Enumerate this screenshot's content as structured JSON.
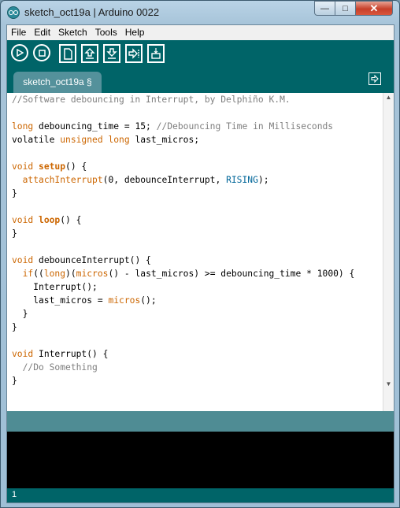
{
  "window": {
    "title": "sketch_oct19a | Arduino 0022",
    "minimize": "—",
    "maximize": "□",
    "close": "✕"
  },
  "menu": [
    "File",
    "Edit",
    "Sketch",
    "Tools",
    "Help"
  ],
  "toolbar": {
    "buttons": [
      "verify",
      "stop",
      "new",
      "open",
      "save",
      "upload",
      "serial-monitor"
    ]
  },
  "tab": {
    "label": "sketch_oct19a §"
  },
  "code_lines": [
    [
      {
        "t": "//Software debouncing in Interrupt, by Delphiño K.M.",
        "c": "cm"
      }
    ],
    [],
    [
      {
        "t": "long",
        "c": "kw"
      },
      {
        "t": " debouncing_time = 15; "
      },
      {
        "t": "//Debouncing Time in Milliseconds",
        "c": "cm"
      }
    ],
    [
      {
        "t": "volatile "
      },
      {
        "t": "unsigned",
        "c": "kw"
      },
      {
        "t": " "
      },
      {
        "t": "long",
        "c": "kw"
      },
      {
        "t": " last_micros;"
      }
    ],
    [],
    [
      {
        "t": "void",
        "c": "kw"
      },
      {
        "t": " "
      },
      {
        "t": "setup",
        "c": "kwb"
      },
      {
        "t": "() {"
      }
    ],
    [
      {
        "t": "  "
      },
      {
        "t": "attachInterrupt",
        "c": "kw"
      },
      {
        "t": "(0, debounceInterrupt, "
      },
      {
        "t": "RISING",
        "c": "lit"
      },
      {
        "t": ");"
      }
    ],
    [
      {
        "t": "}"
      }
    ],
    [],
    [
      {
        "t": "void",
        "c": "kw"
      },
      {
        "t": " "
      },
      {
        "t": "loop",
        "c": "kwb"
      },
      {
        "t": "() {"
      }
    ],
    [
      {
        "t": "}"
      }
    ],
    [],
    [
      {
        "t": "void",
        "c": "kw"
      },
      {
        "t": " debounceInterrupt() {"
      }
    ],
    [
      {
        "t": "  "
      },
      {
        "t": "if",
        "c": "kw"
      },
      {
        "t": "(("
      },
      {
        "t": "long",
        "c": "kw"
      },
      {
        "t": ")("
      },
      {
        "t": "micros",
        "c": "kw"
      },
      {
        "t": "() - last_micros) >= debouncing_time * 1000) {"
      }
    ],
    [
      {
        "t": "    Interrupt();"
      }
    ],
    [
      {
        "t": "    last_micros = "
      },
      {
        "t": "micros",
        "c": "kw"
      },
      {
        "t": "();"
      }
    ],
    [
      {
        "t": "  }"
      }
    ],
    [
      {
        "t": "}"
      }
    ],
    [],
    [
      {
        "t": "void",
        "c": "kw"
      },
      {
        "t": " Interrupt() {"
      }
    ],
    [
      {
        "t": "  "
      },
      {
        "t": "//Do Something",
        "c": "cm"
      }
    ],
    [
      {
        "t": "}"
      }
    ]
  ],
  "status": {
    "line_number": "1"
  },
  "colors": {
    "toolbar": "#006468",
    "status": "#4f8c94",
    "keyword": "#cc6600",
    "comment": "#7e7e7e",
    "constant": "#006699"
  }
}
